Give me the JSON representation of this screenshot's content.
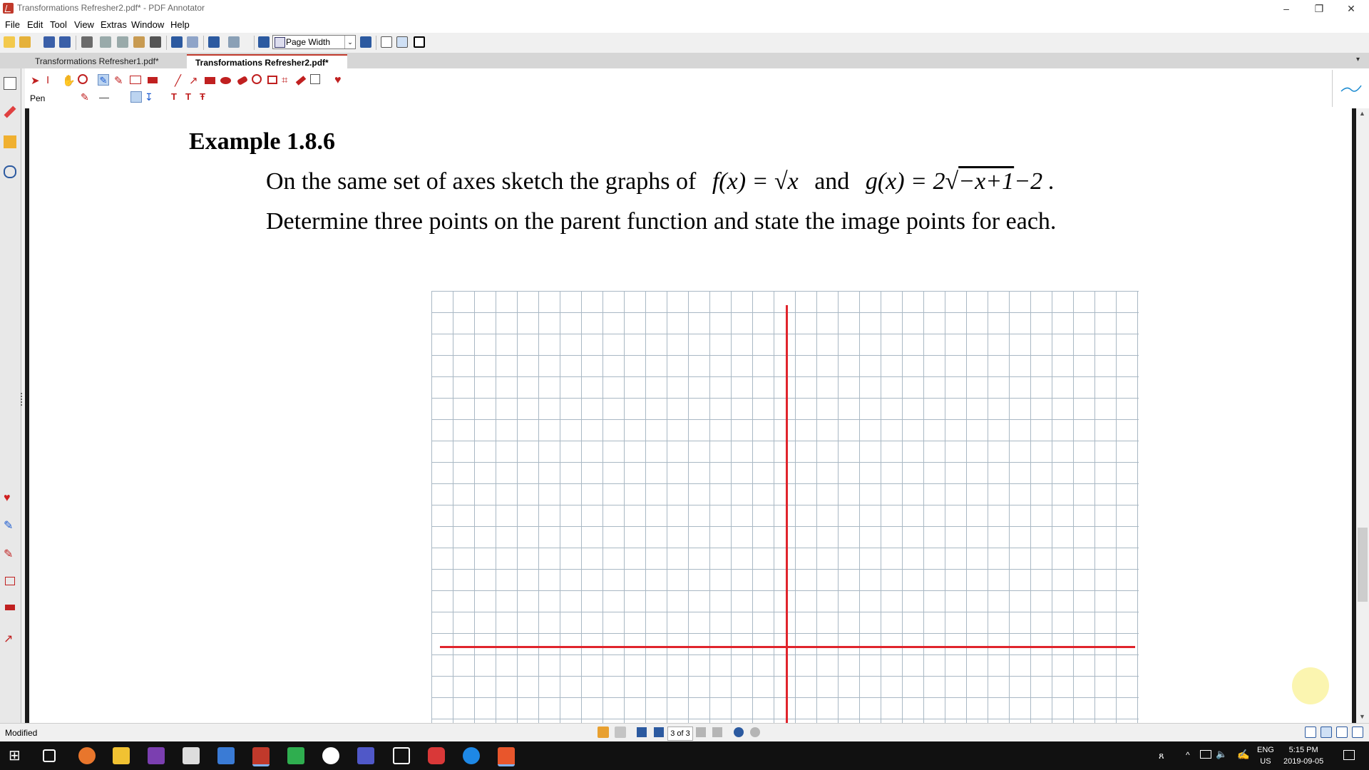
{
  "window": {
    "title": "Transformations Refresher2.pdf* - PDF Annotator",
    "minimize": "–",
    "restore": "❐",
    "close": "✕"
  },
  "menu": [
    "File",
    "Edit",
    "Tool",
    "View",
    "Extras",
    "Window",
    "Help"
  ],
  "toolbar": {
    "zoom_value": "Page Width"
  },
  "tabs": [
    {
      "label": "Transformations Refresher1.pdf*"
    },
    {
      "label": "Transformations Refresher2.pdf*"
    }
  ],
  "annotation_tool": {
    "current_tool_label": "Pen"
  },
  "document": {
    "heading": "Example 1.8.6",
    "line1_text": "On the same set of axes sketch the graphs of",
    "f_def": "f(x) = √x",
    "and_word": "and",
    "g_def_prefix": "g(x) = 2√",
    "g_radicand": "−x+1",
    "g_suffix": "−2 .",
    "line2": "Determine three points on the parent function and state the image points for each."
  },
  "colors": {
    "axis": "#e0242c",
    "grid": "#a9b8c4",
    "accent": "#c0392b"
  },
  "status": {
    "text": "Modified",
    "page_indicator": "3 of 3"
  },
  "taskbar": {
    "lang_line1": "ENG",
    "lang_line2": "US",
    "time": "5:15 PM",
    "date": "2019-09-05"
  },
  "icons": {
    "close_tab_glyph": "✕",
    "tabs_dropdown_glyph": "▾",
    "select_arrow_glyph": "⌄"
  }
}
